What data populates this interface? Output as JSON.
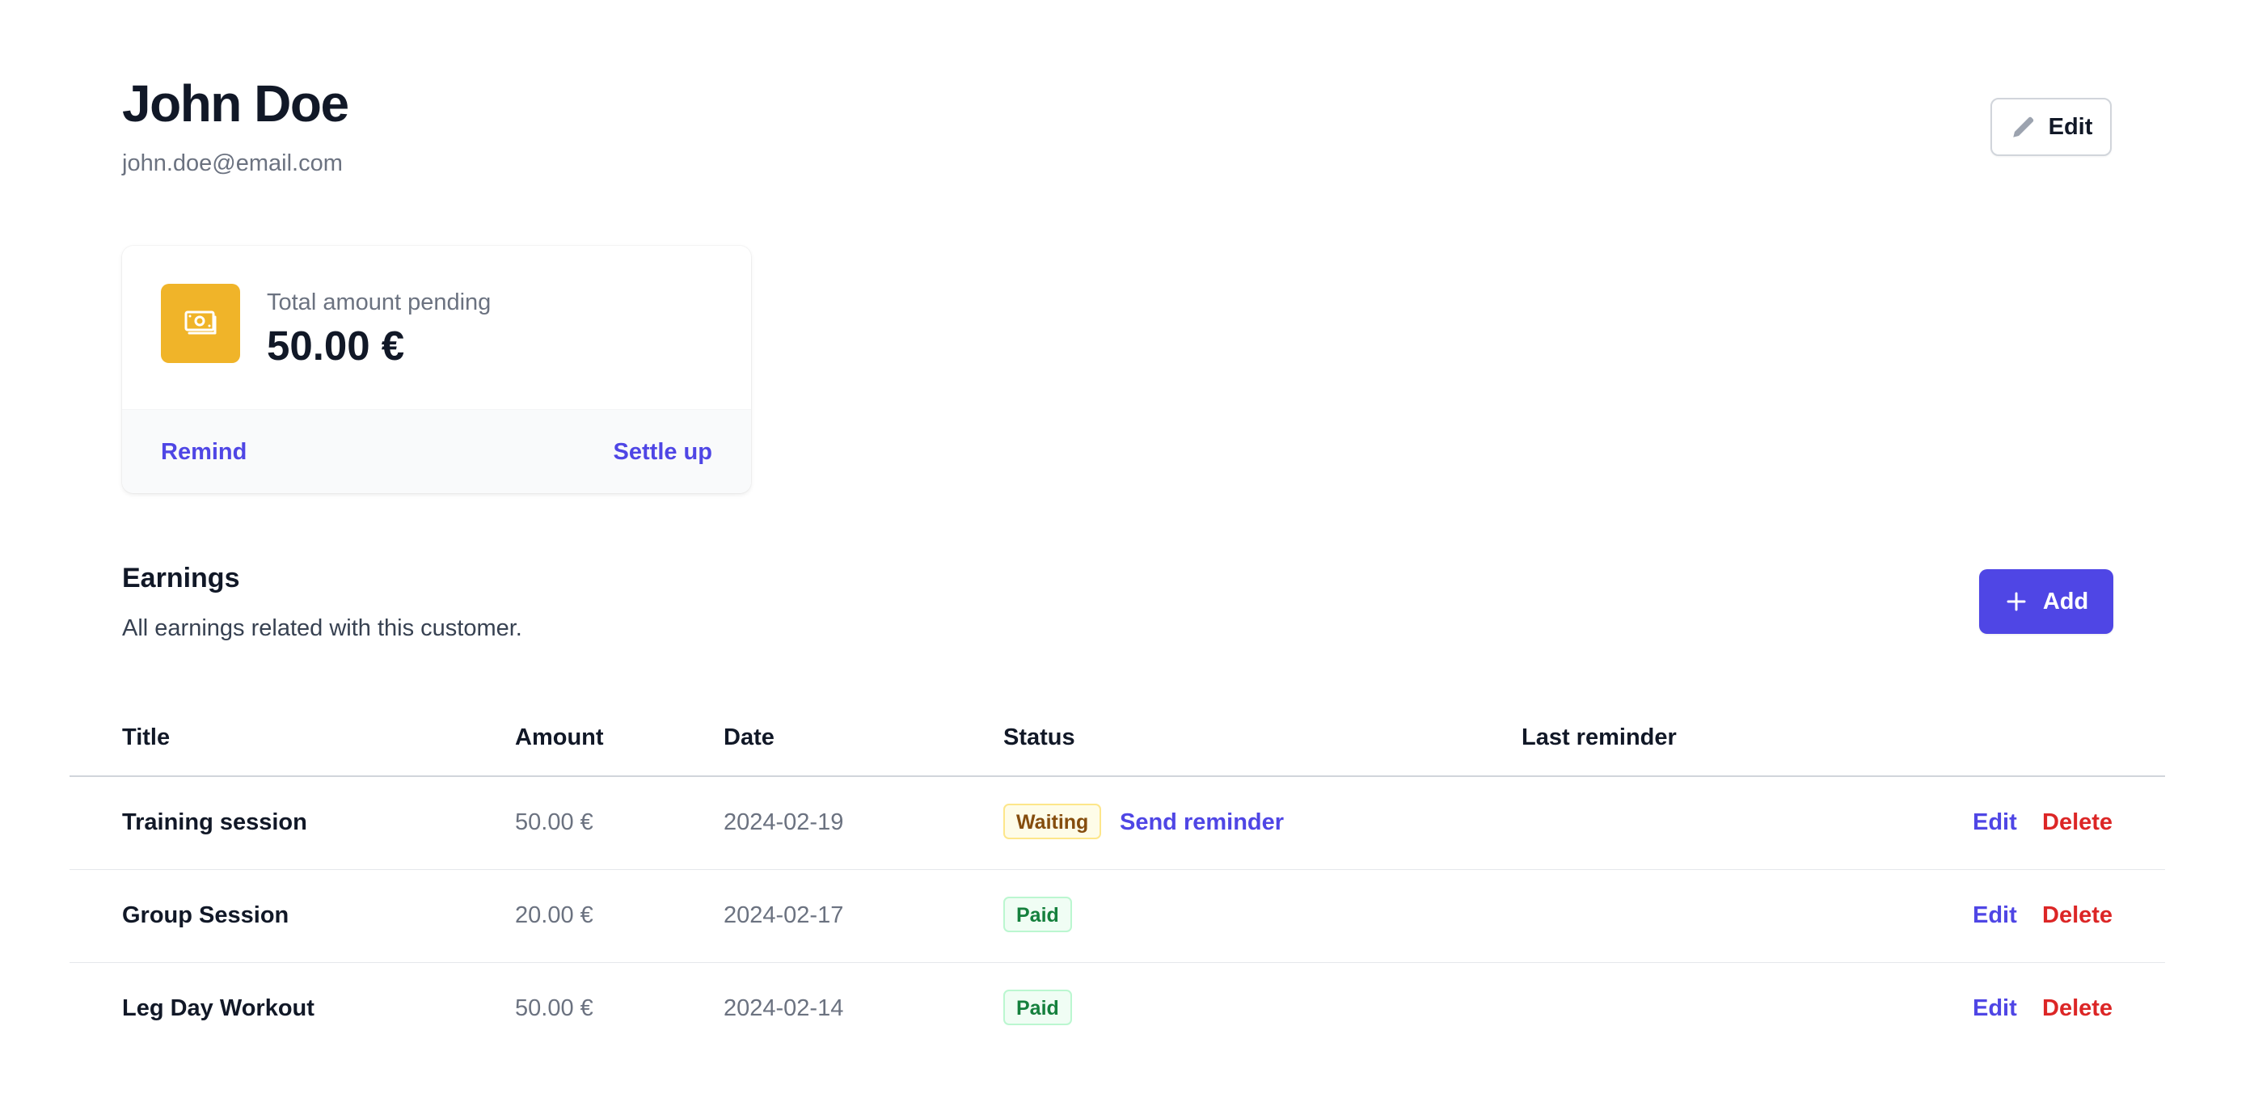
{
  "profile": {
    "name": "John Doe",
    "email": "john.doe@email.com",
    "edit_label": "Edit"
  },
  "pending_card": {
    "label": "Total amount pending",
    "amount": "50.00 €",
    "remind_label": "Remind",
    "settle_label": "Settle up",
    "icon": "banknote-icon",
    "icon_bg": "#f0b429"
  },
  "earnings": {
    "title": "Earnings",
    "subtitle": "All earnings related with this customer.",
    "add_label": "Add"
  },
  "table": {
    "columns": [
      "Title",
      "Amount",
      "Date",
      "Status",
      "Last reminder"
    ],
    "rows": [
      {
        "title": "Training session",
        "amount": "50.00 €",
        "date": "2024-02-19",
        "status": "Waiting",
        "reminder_action": "Send reminder",
        "edit": "Edit",
        "delete": "Delete"
      },
      {
        "title": "Group Session",
        "amount": "20.00 €",
        "date": "2024-02-17",
        "status": "Paid",
        "edit": "Edit",
        "delete": "Delete"
      },
      {
        "title": "Leg Day Workout",
        "amount": "50.00 €",
        "date": "2024-02-14",
        "status": "Paid",
        "edit": "Edit",
        "delete": "Delete"
      }
    ]
  },
  "colors": {
    "accent": "#4f46e5",
    "danger": "#dc2626",
    "waiting": "#854d0e",
    "paid": "#15803d"
  }
}
